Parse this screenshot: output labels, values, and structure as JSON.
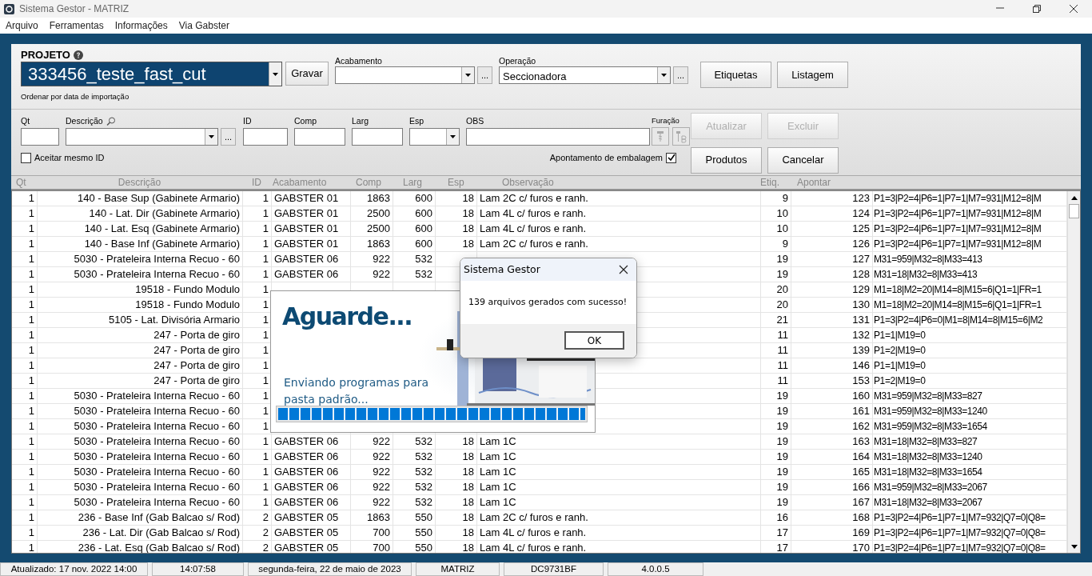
{
  "window": {
    "title": "Sistema Gestor - MATRIZ",
    "menu": [
      "Arquivo",
      "Ferramentas",
      "Informações",
      "Via Gabster"
    ]
  },
  "project": {
    "label": "PROJETO",
    "value": "333456_teste_fast_cut",
    "save_button": "Gravar",
    "hint": "Ordenar por data de importação"
  },
  "selectors": [
    {
      "label": "Acabamento",
      "more_button": "..."
    },
    {
      "label": "Operação",
      "value": "Seccionadora",
      "more_button": "..."
    }
  ],
  "top_buttons": [
    "Etiquetas",
    "Listagem"
  ],
  "form": {
    "fields": [
      {
        "label": "Qt",
        "kind": "input"
      },
      {
        "label": "Descrição",
        "kind": "search-combo",
        "more_button": "..."
      },
      {
        "label": "ID",
        "kind": "input"
      },
      {
        "label": "Comp",
        "kind": "input"
      },
      {
        "label": "Larg",
        "kind": "input"
      },
      {
        "label": "Esp",
        "kind": "combo"
      },
      {
        "label": "OBS",
        "kind": "wide-input"
      }
    ],
    "drilling": {
      "label": "Furação",
      "disabled": true
    },
    "checkboxes": [
      {
        "label": "Aceitar mesmo ID",
        "checked": false
      },
      {
        "label": "Apontamento de embalagem",
        "checked": true
      }
    ],
    "buttons": [
      {
        "label": "Atualizar",
        "disabled": true
      },
      {
        "label": "Excluir",
        "disabled": true
      },
      {
        "label": "Produtos",
        "disabled": false
      },
      {
        "label": "Cancelar",
        "disabled": false
      }
    ]
  },
  "table": {
    "columns": [
      "Qt",
      "Descrição",
      "ID",
      "Acabamento",
      "Comp",
      "Larg",
      "Esp",
      "Observação",
      "Etiq.",
      "Apontar"
    ],
    "rows": [
      {
        "qt": "1",
        "descricao": "140 - Base Sup (Gabinete Armario)",
        "id": "1",
        "acabamento": "GABSTER 01",
        "comp": "1863",
        "larg": "600",
        "esp": "18",
        "observacao": "Lam 2C c/ furos e ranh.",
        "etiq": "9",
        "apontar": "123",
        "column_11": "P1=3|P2=4|P6=1|P7=1|M7=931|M12=8|M"
      },
      {
        "qt": "1",
        "descricao": "140 - Lat. Dir (Gabinete Armario)",
        "id": "1",
        "acabamento": "GABSTER 01",
        "comp": "2500",
        "larg": "600",
        "esp": "18",
        "observacao": "Lam 4L c/ furos e ranh.",
        "etiq": "10",
        "apontar": "124",
        "column_11": "P1=3|P2=4|P6=1|P7=1|M7=931|M12=8|M"
      },
      {
        "qt": "1",
        "descricao": "140 - Lat. Esq (Gabinete Armario)",
        "id": "1",
        "acabamento": "GABSTER 01",
        "comp": "2500",
        "larg": "600",
        "esp": "18",
        "observacao": "Lam 4L c/ furos e ranh.",
        "etiq": "10",
        "apontar": "125",
        "column_11": "P1=3|P2=4|P6=1|P7=1|M7=931|M12=8|M"
      },
      {
        "qt": "1",
        "descricao": "140 - Base Inf (Gabinete Armario)",
        "id": "1",
        "acabamento": "GABSTER 01",
        "comp": "1863",
        "larg": "600",
        "esp": "18",
        "observacao": "Lam 2C c/ furos e ranh.",
        "etiq": "9",
        "apontar": "126",
        "column_11": "P1=3|P2=4|P6=1|P7=1|M7=931|M12=8|M"
      },
      {
        "qt": "1",
        "descricao": "5030 - Prateleira Interna Recuo - 60",
        "id": "1",
        "acabamento": "GABSTER 06",
        "comp": "922",
        "larg": "532",
        "etiq": "19",
        "apontar": "127",
        "column_11": "M31=959|M32=8|M33=413"
      },
      {
        "qt": "1",
        "descricao": "5030 - Prateleira Interna Recuo - 60",
        "id": "1",
        "acabamento": "GABSTER 06",
        "comp": "922",
        "larg": "532",
        "etiq": "19",
        "apontar": "128",
        "column_11": "M31=18|M32=8|M33=413"
      },
      {
        "qt": "1",
        "descricao": "19518 - Fundo Modulo",
        "id": "1",
        "etiq": "20",
        "apontar": "129",
        "column_11": "M1=18|M2=20|M14=8|M15=6|Q1=1|FR=1"
      },
      {
        "qt": "1",
        "descricao": "19518 - Fundo Modulo",
        "id": "1",
        "etiq": "20",
        "apontar": "130",
        "column_11": "M1=18|M2=20|M14=8|M15=6|Q1=1|FR=1"
      },
      {
        "qt": "1",
        "descricao": "5105 - Lat. Divisória Armario",
        "id": "1",
        "etiq": "21",
        "apontar": "131",
        "column_11": "P1=3|P2=4|P6=0|M1=8|M14=8|M15=6|M2"
      },
      {
        "qt": "1",
        "descricao": "247 - Porta de giro",
        "id": "1",
        "etiq": "11",
        "apontar": "132",
        "column_11": "P1=1|M19=0"
      },
      {
        "qt": "1",
        "descricao": "247 - Porta de giro",
        "id": "1",
        "etiq": "11",
        "apontar": "139",
        "column_11": "P1=2|M19=0"
      },
      {
        "qt": "1",
        "descricao": "247 - Porta de giro",
        "id": "1",
        "etiq": "11",
        "apontar": "146",
        "column_11": "P1=1|M19=0"
      },
      {
        "qt": "1",
        "descricao": "247 - Porta de giro",
        "id": "1",
        "etiq": "11",
        "apontar": "153",
        "column_11": "P1=2|M19=0"
      },
      {
        "qt": "1",
        "descricao": "5030 - Prateleira Interna Recuo - 60",
        "id": "1",
        "etiq": "19",
        "apontar": "160",
        "column_11": "M31=959|M32=8|M33=827"
      },
      {
        "qt": "1",
        "descricao": "5030 - Prateleira Interna Recuo - 60",
        "id": "1",
        "etiq": "19",
        "apontar": "161",
        "column_11": "M31=959|M32=8|M33=1240"
      },
      {
        "qt": "1",
        "descricao": "5030 - Prateleira Interna Recuo - 60",
        "id": "1",
        "etiq": "19",
        "apontar": "162",
        "column_11": "M31=959|M32=8|M33=1654"
      },
      {
        "qt": "1",
        "descricao": "5030 - Prateleira Interna Recuo - 60",
        "id": "1",
        "acabamento": "GABSTER 06",
        "comp": "922",
        "larg": "532",
        "esp": "18",
        "observacao": "Lam 1C",
        "etiq": "19",
        "apontar": "163",
        "column_11": "M31=18|M32=8|M33=827"
      },
      {
        "qt": "1",
        "descricao": "5030 - Prateleira Interna Recuo - 60",
        "id": "1",
        "acabamento": "GABSTER 06",
        "comp": "922",
        "larg": "532",
        "esp": "18",
        "observacao": "Lam 1C",
        "etiq": "19",
        "apontar": "164",
        "column_11": "M31=18|M32=8|M33=1240"
      },
      {
        "qt": "1",
        "descricao": "5030 - Prateleira Interna Recuo - 60",
        "id": "1",
        "acabamento": "GABSTER 06",
        "comp": "922",
        "larg": "532",
        "esp": "18",
        "observacao": "Lam 1C",
        "etiq": "19",
        "apontar": "165",
        "column_11": "M31=18|M32=8|M33=1654"
      },
      {
        "qt": "1",
        "descricao": "5030 - Prateleira Interna Recuo - 60",
        "id": "1",
        "acabamento": "GABSTER 06",
        "comp": "922",
        "larg": "532",
        "esp": "18",
        "observacao": "Lam 1C",
        "etiq": "19",
        "apontar": "166",
        "column_11": "M31=959|M32=8|M33=2067"
      },
      {
        "qt": "1",
        "descricao": "5030 - Prateleira Interna Recuo - 60",
        "id": "1",
        "acabamento": "GABSTER 06",
        "comp": "922",
        "larg": "532",
        "esp": "18",
        "observacao": "Lam 1C",
        "etiq": "19",
        "apontar": "167",
        "column_11": "M31=18|M32=8|M33=2067"
      },
      {
        "qt": "1",
        "descricao": "236 - Base Inf (Gab Balcao s/ Rod)",
        "id": "2",
        "acabamento": "GABSTER 05",
        "comp": "1863",
        "larg": "550",
        "esp": "18",
        "observacao": "Lam 2C c/ furos e ranh.",
        "etiq": "16",
        "apontar": "168",
        "column_11": "P1=3|P2=4|P6=1|P7=1|M7=932|Q7=0|Q8="
      },
      {
        "qt": "1",
        "descricao": "236 - Lat. Dir (Gab Balcao s/ Rod)",
        "id": "2",
        "acabamento": "GABSTER 05",
        "comp": "700",
        "larg": "550",
        "esp": "18",
        "observacao": "Lam 4L c/ furos e ranh.",
        "etiq": "17",
        "apontar": "169",
        "column_11": "P1=3|P2=4|P6=1|P7=1|M7=932|Q7=0|Q8="
      },
      {
        "qt": "1",
        "descricao": "236 - Lat. Esq (Gab Balcao s/ Rod)",
        "id": "2",
        "acabamento": "GABSTER 05",
        "comp": "700",
        "larg": "550",
        "esp": "18",
        "observacao": "Lam 4L c/ furos e ranh.",
        "etiq": "17",
        "apontar": "170",
        "column_11": "P1=3|P2=4|P6=1|P7=1|M7=932|Q7=0|Q8="
      }
    ]
  },
  "splash": {
    "title": "Aguarde...",
    "message": "Enviando programas para pasta padrão...",
    "level": 1
  },
  "dialog": {
    "title": "Sistema Gestor",
    "message": "139 arquivos gerados com sucesso!",
    "button": "OK"
  },
  "status_bar": [
    "Atualizado: 17 nov. 2022 14:00",
    "14:07:58",
    "segunda-feira, 22 de maio de 2023",
    "MATRIZ",
    "DC9731BF",
    "4.0.0.5"
  ]
}
